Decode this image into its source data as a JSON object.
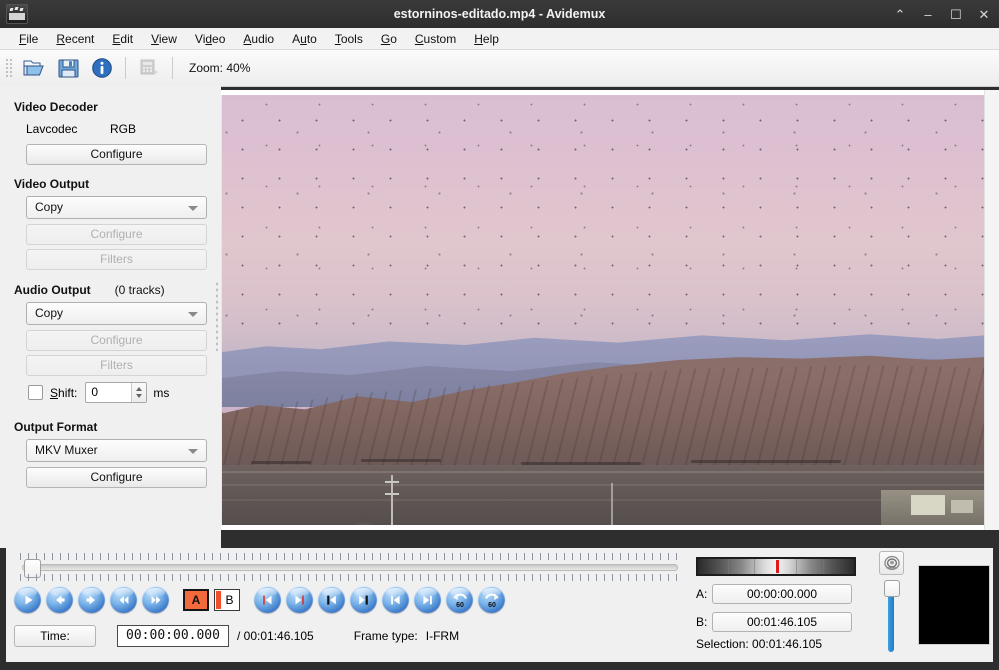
{
  "window": {
    "title": "estorninos-editado.mp4 - Avidemux",
    "app_icon": "film-clapper-icon",
    "controls": [
      {
        "name": "shade-button",
        "glyph": "⌃"
      },
      {
        "name": "minimize-button",
        "glyph": "–"
      },
      {
        "name": "maximize-button",
        "glyph": "☐"
      },
      {
        "name": "close-button",
        "glyph": "✕"
      }
    ]
  },
  "menubar": {
    "items": [
      {
        "label": "File",
        "mnemonic": "F"
      },
      {
        "label": "Recent",
        "mnemonic": "R"
      },
      {
        "label": "Edit",
        "mnemonic": "E"
      },
      {
        "label": "View",
        "mnemonic": "V"
      },
      {
        "label": "Video",
        "mnemonic": "d"
      },
      {
        "label": "Audio",
        "mnemonic": "A"
      },
      {
        "label": "Auto",
        "mnemonic": "u"
      },
      {
        "label": "Tools",
        "mnemonic": "T"
      },
      {
        "label": "Go",
        "mnemonic": "G"
      },
      {
        "label": "Custom",
        "mnemonic": "C"
      },
      {
        "label": "Help",
        "mnemonic": "H"
      }
    ]
  },
  "toolbar": {
    "buttons": [
      {
        "name": "open-file-icon",
        "enabled": true
      },
      {
        "name": "save-file-icon",
        "enabled": true
      },
      {
        "name": "info-icon",
        "enabled": true
      },
      {
        "name": "calculator-icon",
        "enabled": false
      }
    ],
    "zoom_label": "Zoom: 40%"
  },
  "left_panel": {
    "video_decoder": {
      "title": "Video Decoder",
      "codec": "Lavcodec",
      "colorspace": "RGB",
      "configure_label": "Configure"
    },
    "video_output": {
      "title": "Video Output",
      "selected": "Copy",
      "configure_label": "Configure",
      "filters_label": "Filters"
    },
    "audio_output": {
      "title": "Audio Output",
      "tracks": "(0 tracks)",
      "selected": "Copy",
      "configure_label": "Configure",
      "filters_label": "Filters",
      "shift_label": "Shift:",
      "shift_value": "0",
      "shift_units": "ms"
    },
    "output_format": {
      "title": "Output Format",
      "selected": "MKV Muxer",
      "configure_label": "Configure"
    }
  },
  "player": {
    "transport": [
      {
        "name": "play-button",
        "icon": "play-icon"
      },
      {
        "name": "step-backward-button",
        "icon": "arrow-left-icon"
      },
      {
        "name": "step-forward-button",
        "icon": "arrow-right-icon"
      },
      {
        "name": "rewind-button",
        "icon": "double-arrow-left-icon"
      },
      {
        "name": "fast-forward-button",
        "icon": "double-arrow-right-icon"
      }
    ],
    "marker_a_label": "A",
    "marker_b_label": "B",
    "navigation": [
      {
        "name": "previous-keyframe-button",
        "icon": "prev-keyframe-icon"
      },
      {
        "name": "next-keyframe-button",
        "icon": "next-keyframe-icon"
      },
      {
        "name": "previous-black-frame-button",
        "icon": "prev-blackframe-icon"
      },
      {
        "name": "next-black-frame-button",
        "icon": "next-blackframe-icon"
      },
      {
        "name": "go-to-start-button",
        "icon": "skip-start-icon"
      },
      {
        "name": "go-to-end-button",
        "icon": "skip-end-icon"
      },
      {
        "name": "jump-back-60s-button",
        "icon": "back-60s-icon",
        "badge": "60"
      },
      {
        "name": "jump-forward-60s-button",
        "icon": "forward-60s-icon",
        "badge": "60"
      }
    ]
  },
  "status": {
    "time_button_label": "Time:",
    "current_time": "00:00:00.000",
    "total_time": "/ 00:01:46.105",
    "frame_type_label": "Frame type:",
    "frame_type_value": "I-FRM"
  },
  "selection": {
    "a_label": "A:",
    "a_value": "00:00:00.000",
    "b_label": "B:",
    "b_value": "00:01:46.105",
    "summary": "Selection: 00:01:46.105",
    "volume_icon": "speaker-icon"
  },
  "colors": {
    "accent_blue": "#3f7fcc",
    "marker_red": "#e01b1b",
    "panel_bg": "#f0f0f0",
    "frame_dark": "#2e2e2e",
    "titlebar": "#3a3a3a"
  }
}
